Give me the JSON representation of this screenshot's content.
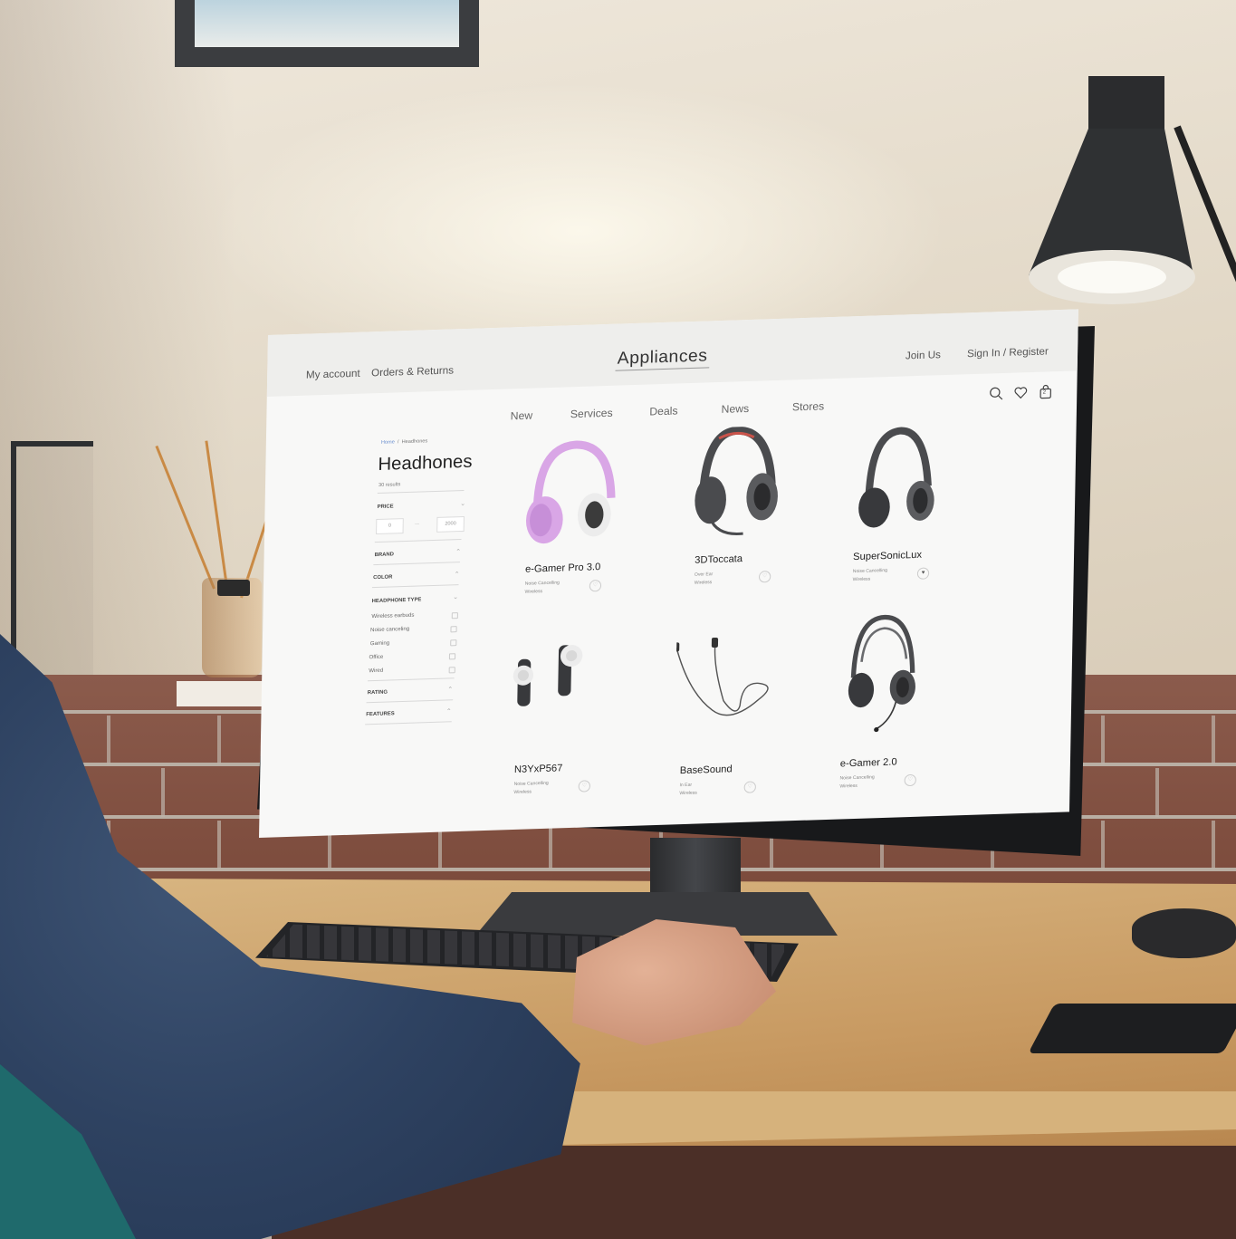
{
  "header": {
    "my_account": "My account",
    "orders_returns": "Orders & Returns",
    "brand": "Appliances",
    "join_us": "Join Us",
    "sign_in": "Sign In / Register"
  },
  "nav": {
    "items": [
      {
        "label": "New"
      },
      {
        "label": "Services"
      },
      {
        "label": "Deals"
      },
      {
        "label": "News"
      },
      {
        "label": "Stores"
      }
    ]
  },
  "icons": {
    "search": "search-icon",
    "wishlist": "heart-icon",
    "cart": "bag-icon",
    "cart_count": "2"
  },
  "breadcrumb": {
    "home": "Home",
    "separator": "/",
    "current": "Headhones"
  },
  "page": {
    "title": "Headhones",
    "results": "30 results"
  },
  "filters": {
    "price": {
      "label": "PRICE",
      "min": "0",
      "dash": "—",
      "max": "2000"
    },
    "brand": "BRAND",
    "color": "COLOR",
    "headphone_type": {
      "label": "HEADPHONE TYPE",
      "options": [
        {
          "label": "Wireless earbuds"
        },
        {
          "label": "Noise canceling"
        },
        {
          "label": "Gaming"
        },
        {
          "label": "Office"
        },
        {
          "label": "Wired"
        }
      ]
    },
    "rating": "RATING",
    "features": "FEATURES"
  },
  "products": [
    {
      "name": "e-Gamer Pro 3.0",
      "line1": "Noise Cancelling",
      "line2": "Wireless",
      "kind": "over-ear-pink",
      "favorited": false
    },
    {
      "name": "3DToccata",
      "line1": "Over Ear",
      "line2": "Wireless",
      "kind": "gaming-headset",
      "favorited": false
    },
    {
      "name": "SuperSonicLux",
      "line1": "Noise Cancelling",
      "line2": "Wireless",
      "kind": "over-ear-gray",
      "favorited": true
    },
    {
      "name": "N3YxP567",
      "line1": "Noise Cancelling",
      "line2": "Wireless",
      "kind": "earbuds",
      "favorited": false
    },
    {
      "name": "BaseSound",
      "line1": "In Ear",
      "line2": "Wireless",
      "kind": "wired-earphones",
      "favorited": false
    },
    {
      "name": "e-Gamer 2.0",
      "line1": "Noise Cancelling",
      "line2": "Wireless",
      "kind": "headset-mic",
      "favorited": false
    }
  ],
  "colors": {
    "accent_link": "#6a8fcf",
    "product_pink": "#d9a6e6",
    "product_dark": "#4a4b4e"
  }
}
